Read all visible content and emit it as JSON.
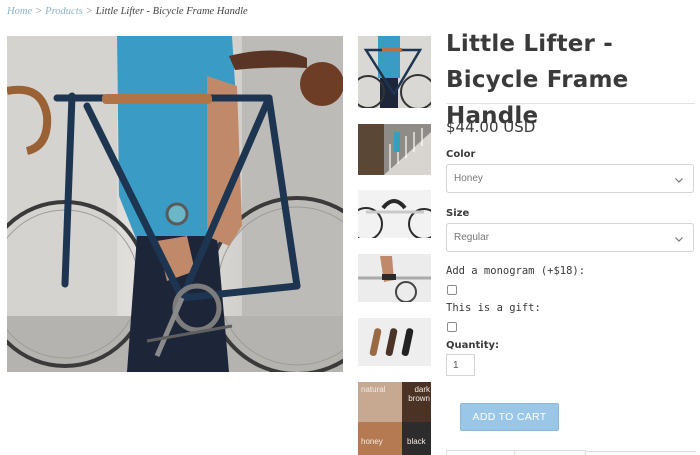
{
  "breadcrumb": {
    "home": "Home",
    "separator": ">",
    "products": "Products",
    "current": "Little Lifter - Bicycle Frame Handle"
  },
  "product": {
    "title": "Little Lifter - Bicycle Frame Handle",
    "price": "$44.00 USD"
  },
  "options": {
    "color_label": "Color",
    "color_value": "Honey",
    "size_label": "Size",
    "size_value": "Regular",
    "monogram_label": "Add a monogram (+$18):",
    "gift_label": "This is a gift:",
    "quantity_label": "Quantity:",
    "quantity_value": "1"
  },
  "cart": {
    "add_to_cart": "ADD TO CART"
  },
  "swatches": {
    "natural": "natural",
    "dark_brown": "dark brown",
    "honey": "honey",
    "black": "black"
  },
  "colors": {
    "link": "#8bb3cc",
    "button": "#9ac6e8",
    "bike_frame": "#1d3550",
    "shirt": "#3a9cc4",
    "leather_honey": "#b07448"
  },
  "icons": {
    "select_chevron": "chevron-down-icon"
  }
}
